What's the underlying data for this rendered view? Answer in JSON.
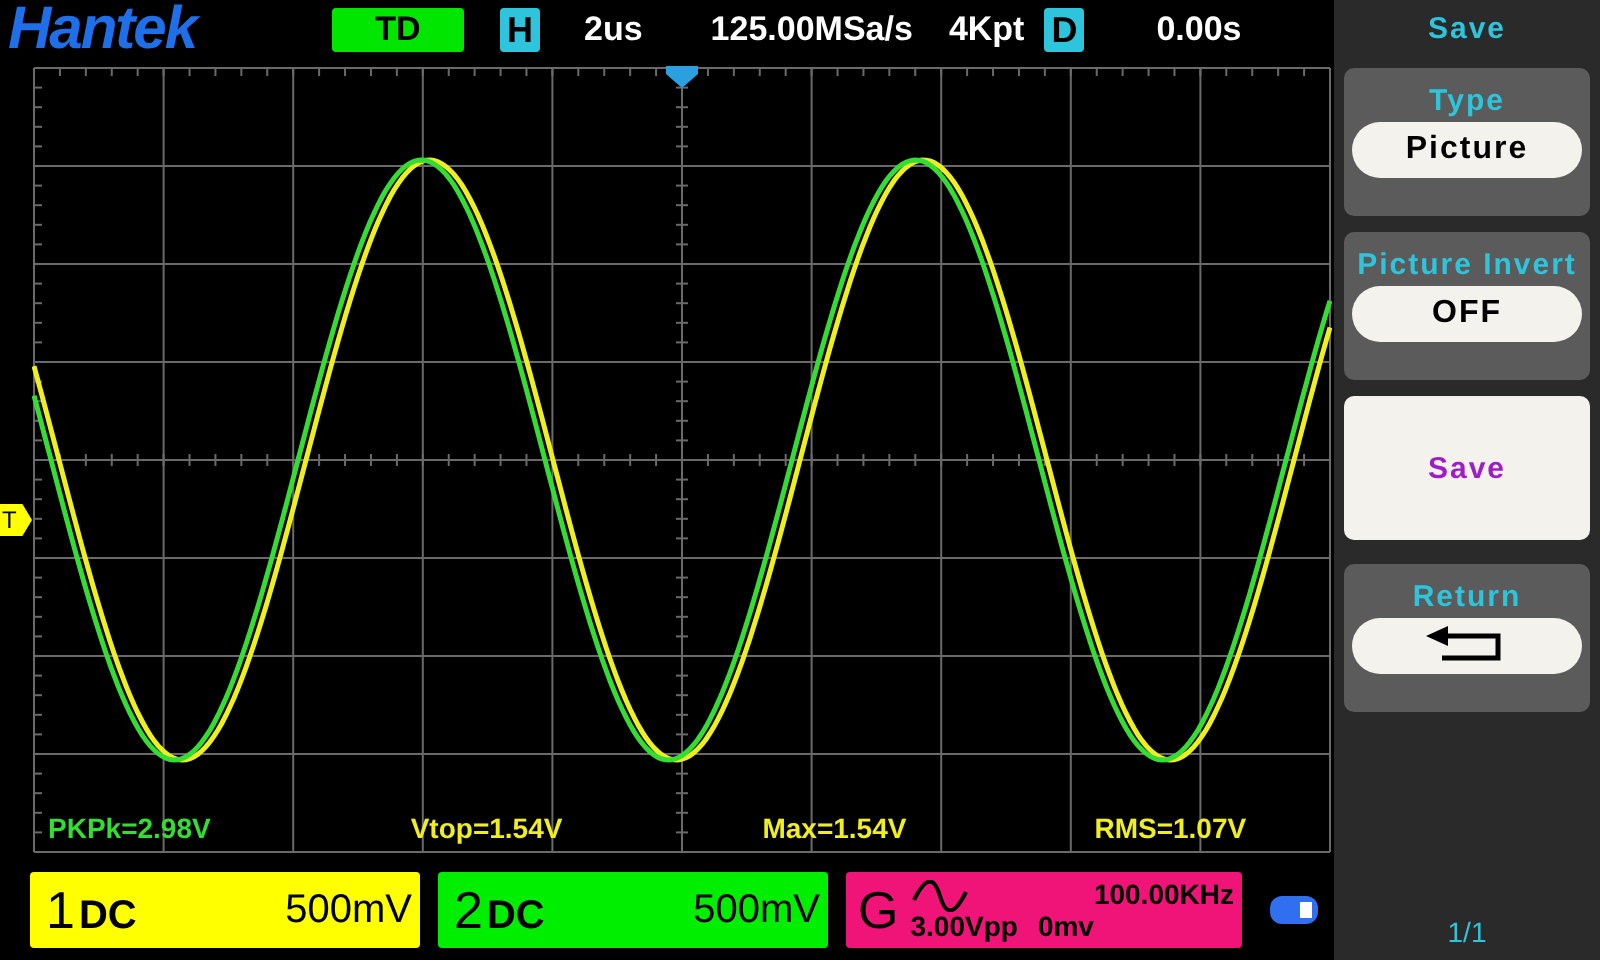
{
  "header": {
    "logo": "Hantek",
    "mode": "TD",
    "h_label": "H",
    "timebase": "2us",
    "sample_rate": "125.00MSa/s",
    "memory": "4Kpt",
    "d_label": "D",
    "delay": "0.00s"
  },
  "trigger_marker": "T",
  "measurements": [
    {
      "text": "PKPk=2.98V",
      "color": "#33dd33"
    },
    {
      "text": "Vtop=1.54V",
      "color": "#eeee22"
    },
    {
      "text": "Max=1.54V",
      "color": "#eeee22"
    },
    {
      "text": "RMS=1.07V",
      "color": "#eeee22"
    }
  ],
  "channels": [
    {
      "number": "1",
      "coupling": "DC",
      "scale": "500mV",
      "color": "#ffff00"
    },
    {
      "number": "2",
      "coupling": "DC",
      "scale": "500mV",
      "color": "#00ee00"
    }
  ],
  "generator": {
    "label": "G",
    "frequency": "100.00KHz",
    "amplitude": "3.00Vpp",
    "offset": "0mv"
  },
  "menu": {
    "title": "Save",
    "items": [
      {
        "kind": "option",
        "label": "Type",
        "value": "Picture"
      },
      {
        "kind": "option",
        "label": "Picture Invert",
        "value": "OFF"
      },
      {
        "kind": "action",
        "label": "Save"
      },
      {
        "kind": "return",
        "label": "Return"
      }
    ],
    "page": "1/1"
  }
}
